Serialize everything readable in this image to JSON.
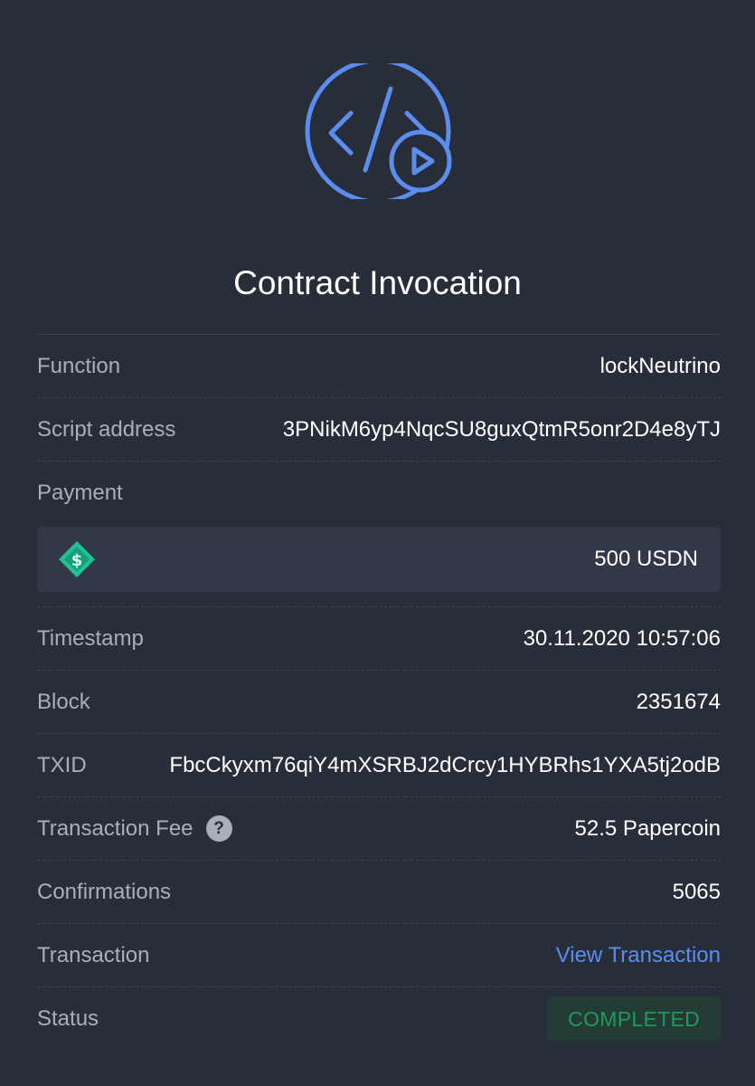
{
  "header": {
    "title": "Contract Invocation",
    "icon": "code-play-icon",
    "accent_color": "#5b8def"
  },
  "details": {
    "function_label": "Function",
    "function_value": "lockNeutrino",
    "script_address_label": "Script address",
    "script_address_value": "3PNikM6yp4NqcSU8guxQtmR5onr2D4e8yTJ",
    "payment_label": "Payment",
    "payment_amount": "500 USDN",
    "payment_asset_icon": "usdn-icon",
    "timestamp_label": "Timestamp",
    "timestamp_value": "30.11.2020 10:57:06",
    "block_label": "Block",
    "block_value": "2351674",
    "txid_label": "TXID",
    "txid_value": "FbcCkyxm76qiY4mXSRBJ2dCrcy1HYBRhs1YXA5tj2odB",
    "fee_label": "Transaction Fee",
    "fee_value": "52.5 Papercoin",
    "fee_help_icon": "question-icon",
    "confirmations_label": "Confirmations",
    "confirmations_value": "5065",
    "transaction_label": "Transaction",
    "transaction_link": "View Transaction",
    "status_label": "Status",
    "status_value": "COMPLETED",
    "status_color": "#1e9a5c"
  }
}
